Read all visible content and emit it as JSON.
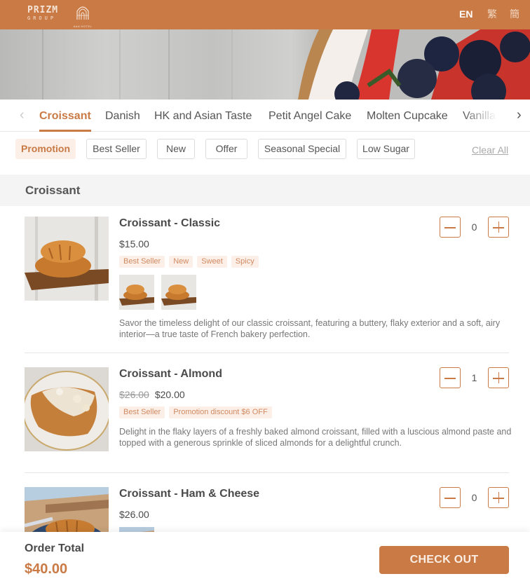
{
  "header": {
    "brand_top": "PRIZM",
    "brand_bottom": "GROUP",
    "hotel_caption": "AAA HOTEL",
    "languages": [
      "EN",
      "繁",
      "簡"
    ],
    "active_language": "EN"
  },
  "hero": {
    "image": "berry-tart-banner"
  },
  "category_tabs": {
    "active": "Croissant",
    "items": [
      "Croissant",
      "Danish",
      "HK and Asian Taste",
      "Petit Angel Cake",
      "Molten Cupcake",
      "Vanilla F"
    ]
  },
  "filters": {
    "chips": [
      "Promotion",
      "Best Seller",
      "New",
      "Offer",
      "Seasonal Special",
      "Low Sugar"
    ],
    "active": "Promotion",
    "clear_all": "Clear All"
  },
  "section": {
    "title": "Croissant"
  },
  "products": [
    {
      "name": "Croissant - Classic",
      "price": "$15.00",
      "original_price": null,
      "tags": [
        "Best Seller",
        "New",
        "Sweet",
        "Spicy"
      ],
      "thumbnail_count": 2,
      "description": "Savor the timeless delight of our classic croissant, featuring a buttery, flaky exterior and a soft, airy interior—a true taste of French bakery perfection.",
      "quantity": "0"
    },
    {
      "name": "Croissant - Almond",
      "price": "$20.00",
      "original_price": "$26.00",
      "tags": [
        "Best Seller",
        "Promotion discount $6 OFF"
      ],
      "thumbnail_count": 0,
      "description": "Delight in the flaky layers of a freshly baked almond croissant, filled with a luscious almond paste and topped with a generous sprinkle of sliced almonds for a delightful crunch.",
      "quantity": "1"
    },
    {
      "name": "Croissant - Ham & Cheese",
      "price": "$26.00",
      "original_price": null,
      "tags": [],
      "thumbnail_count": 1,
      "description": "",
      "quantity": "0"
    }
  ],
  "footer": {
    "order_total_label": "Order Total",
    "order_total_value": "$40.00",
    "checkout_label": "CHECK OUT"
  },
  "colors": {
    "brand": "#c97a45",
    "tag_bg": "#fbefe7",
    "tag_text": "#d08a62",
    "section_bg": "#f4f4f4"
  }
}
